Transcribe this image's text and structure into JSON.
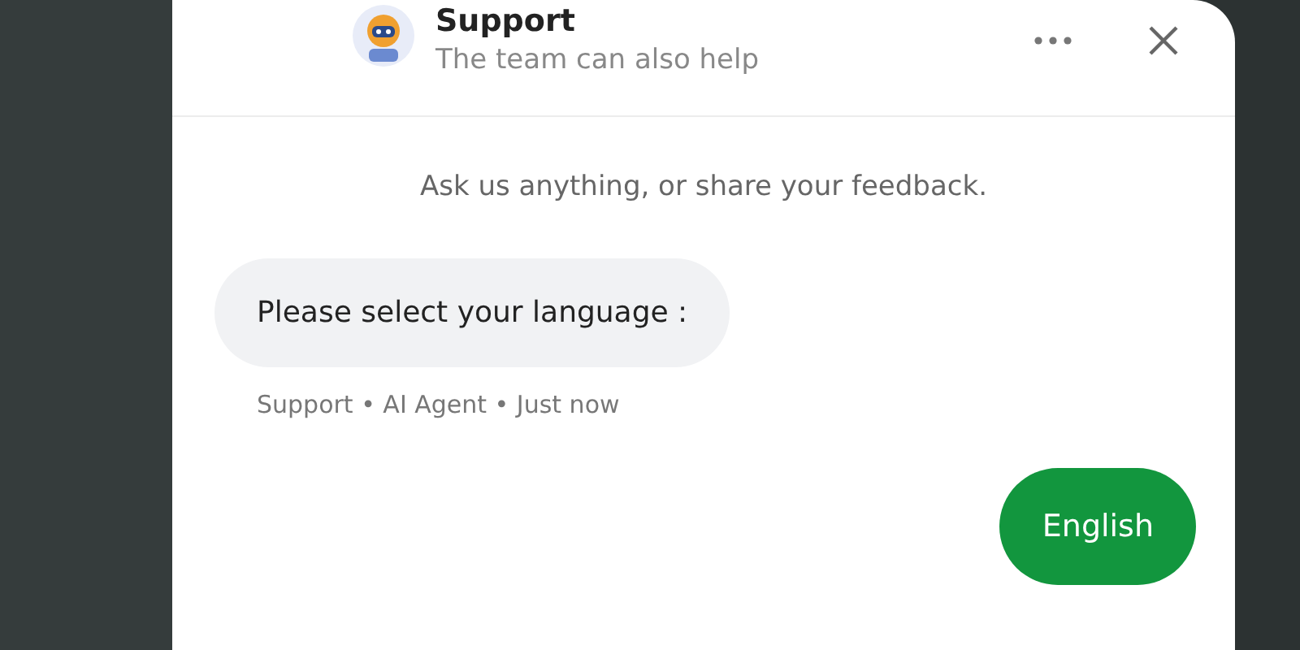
{
  "header": {
    "title": "Support",
    "subtitle": "The team can also help"
  },
  "intro": "Ask us anything, or share your feedback.",
  "messages": [
    {
      "kind": "bot",
      "text": "Please select your language :",
      "meta": "Support • AI Agent • Just now"
    }
  ],
  "options": [
    {
      "label": "English"
    }
  ]
}
